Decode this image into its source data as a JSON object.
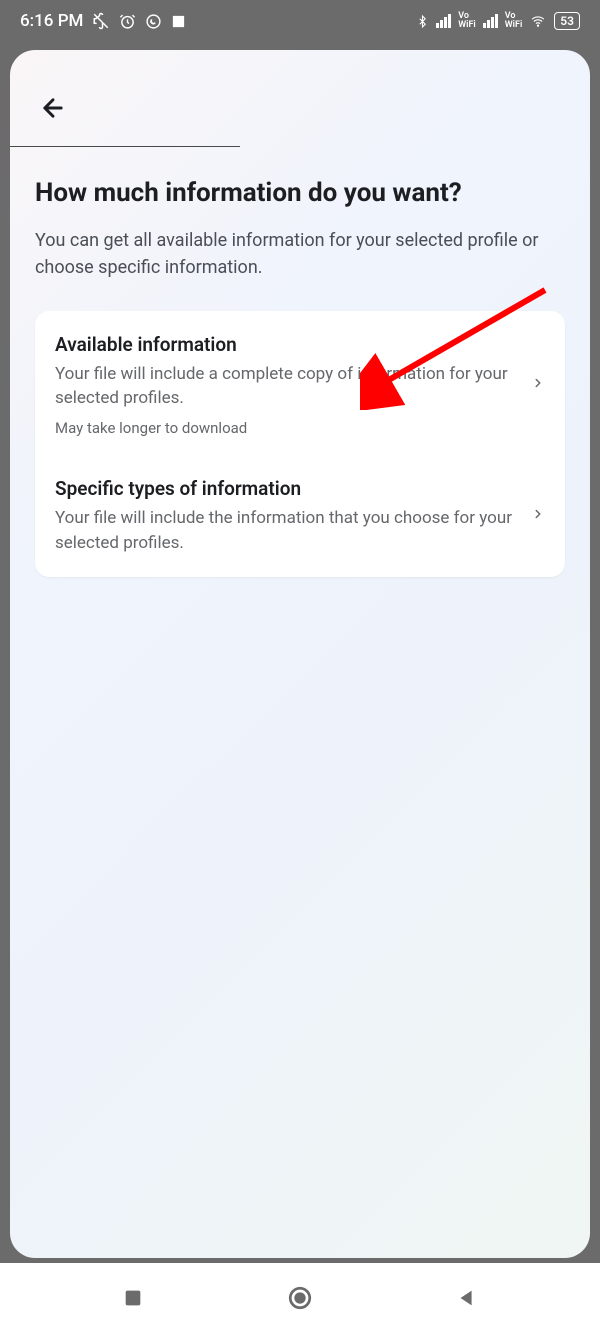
{
  "status": {
    "time": "6:16 PM",
    "battery": "53"
  },
  "page": {
    "title": "How much information do you want?",
    "subtitle": "You can get all available information for your selected profile or choose specific information."
  },
  "options": [
    {
      "title": "Available information",
      "description": "Your file will include a complete copy of information for your selected profiles.",
      "note": "May take longer to download"
    },
    {
      "title": "Specific types of information",
      "description": "Your file will include the information that you choose for your selected profiles.",
      "note": ""
    }
  ]
}
